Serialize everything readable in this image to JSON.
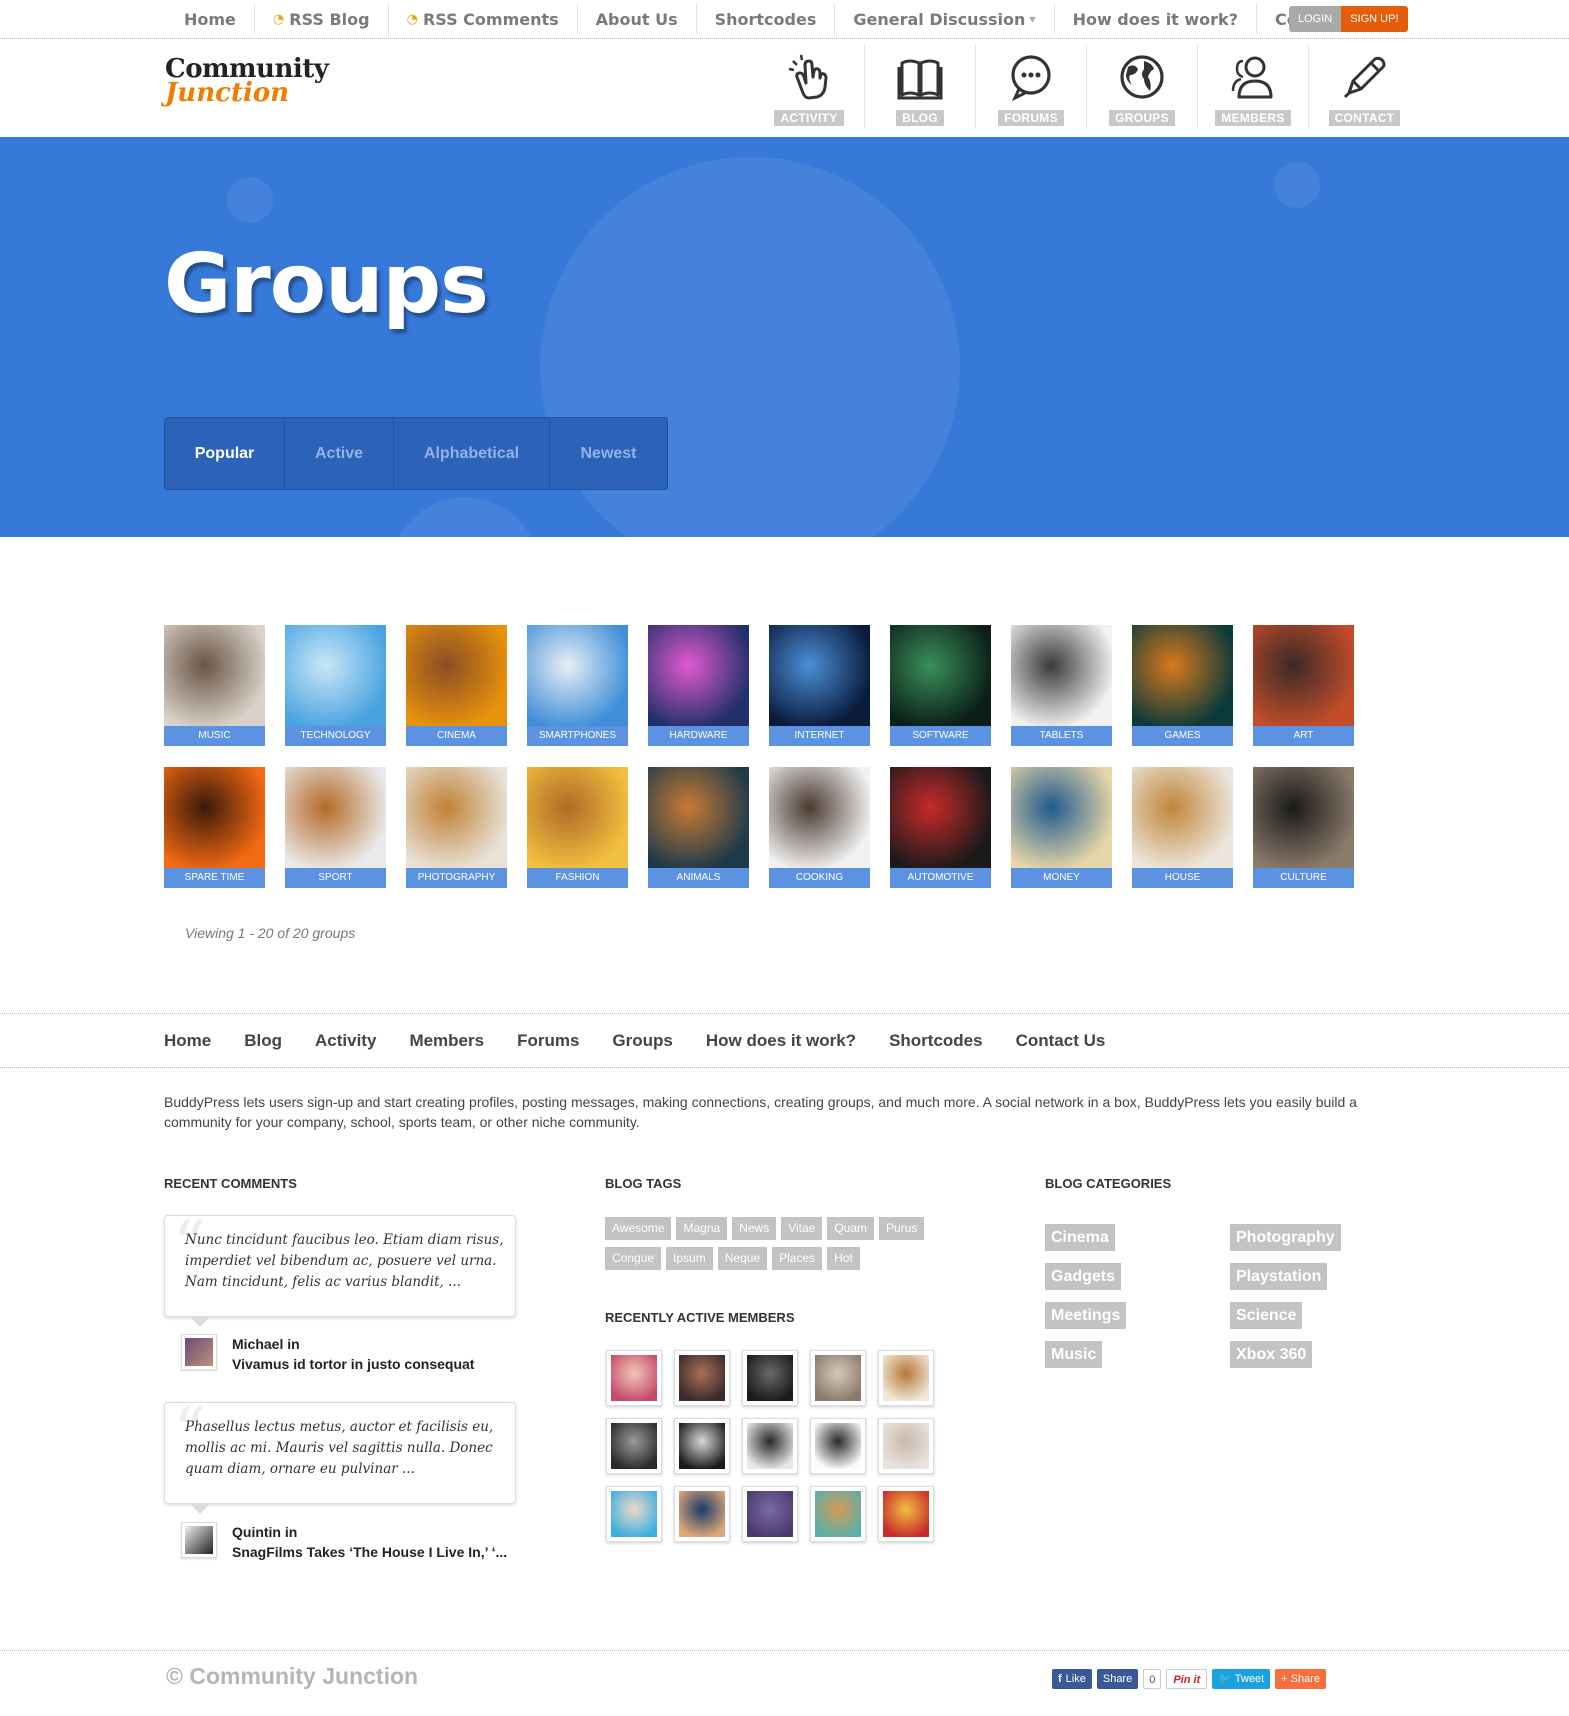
{
  "topnav": {
    "items": [
      {
        "label": "Home",
        "rss": false
      },
      {
        "label": "RSS Blog",
        "rss": true
      },
      {
        "label": "RSS Comments",
        "rss": true
      },
      {
        "label": "About Us",
        "rss": false
      },
      {
        "label": "Shortcodes",
        "rss": false
      },
      {
        "label": "General Discussion",
        "rss": false,
        "caret": true
      },
      {
        "label": "How does it work?",
        "rss": false
      },
      {
        "label": "Contact Us",
        "rss": false
      }
    ],
    "login": "LOGIN",
    "signup": "SIGN UP!"
  },
  "logo": {
    "line1": "Community",
    "line2": "Junction"
  },
  "iconnav": [
    {
      "label": "ACTIVITY",
      "icon": "pointer-hand-icon"
    },
    {
      "label": "BLOG",
      "icon": "book-icon"
    },
    {
      "label": "FORUMS",
      "icon": "chat-bubbles-icon"
    },
    {
      "label": "GROUPS",
      "icon": "globe-icon"
    },
    {
      "label": "MEMBERS",
      "icon": "people-icon"
    },
    {
      "label": "CONTACT",
      "icon": "pencil-icon"
    }
  ],
  "hero": {
    "title": "Groups",
    "tabs": [
      {
        "label": "Popular",
        "active": true
      },
      {
        "label": "Active",
        "active": false
      },
      {
        "label": "Alphabetical",
        "active": false
      },
      {
        "label": "Newest",
        "active": false
      }
    ]
  },
  "groups": [
    {
      "label": "MUSIC",
      "colors": [
        "#d8d2c8",
        "#6b5446"
      ]
    },
    {
      "label": "TECHNOLOGY",
      "colors": [
        "#4aa3e0",
        "#c8e7f7"
      ]
    },
    {
      "label": "CINEMA",
      "colors": [
        "#e8920c",
        "#8a4d24"
      ]
    },
    {
      "label": "SMARTPHONES",
      "colors": [
        "#3f8fd8",
        "#e8eef5"
      ]
    },
    {
      "label": "HARDWARE",
      "colors": [
        "#21306a",
        "#e05ad0"
      ]
    },
    {
      "label": "INTERNET",
      "colors": [
        "#0a1a3a",
        "#4b8fd6"
      ]
    },
    {
      "label": "SOFTWARE",
      "colors": [
        "#0b1e18",
        "#3a8f59"
      ]
    },
    {
      "label": "TABLETS",
      "colors": [
        "#f2f2f2",
        "#3a3a3a"
      ]
    },
    {
      "label": "GAMES",
      "colors": [
        "#0c3a3a",
        "#d87a1c"
      ]
    },
    {
      "label": "ART",
      "colors": [
        "#c24c2a",
        "#3a2a28"
      ]
    },
    {
      "label": "SPARE TIME",
      "colors": [
        "#f36a12",
        "#3a1a0a"
      ]
    },
    {
      "label": "SPORT",
      "colors": [
        "#eaeaea",
        "#b46a28"
      ]
    },
    {
      "label": "PHOTOGRAPHY",
      "colors": [
        "#e8e2d8",
        "#c08236"
      ]
    },
    {
      "label": "FASHION",
      "colors": [
        "#f2c040",
        "#b06a24"
      ]
    },
    {
      "label": "ANIMALS",
      "colors": [
        "#1e3a4a",
        "#c87a34"
      ]
    },
    {
      "label": "COOKING",
      "colors": [
        "#f2f2f2",
        "#4a3a30"
      ]
    },
    {
      "label": "AUTOMOTIVE",
      "colors": [
        "#1a1a1a",
        "#c82a2a"
      ]
    },
    {
      "label": "MONEY",
      "colors": [
        "#e6d6a8",
        "#1f5a8e"
      ]
    },
    {
      "label": "HOUSE",
      "colors": [
        "#ece6dc",
        "#c0863a"
      ]
    },
    {
      "label": "CULTURE",
      "colors": [
        "#8a7a6a",
        "#1a1a1a"
      ]
    }
  ],
  "viewing": "Viewing 1 - 20 of 20 groups",
  "footer_nav": [
    "Home",
    "Blog",
    "Activity",
    "Members",
    "Forums",
    "Groups",
    "How does it work?",
    "Shortcodes",
    "Contact Us"
  ],
  "about": "BuddyPress lets users sign-up and start creating profiles, posting messages, making connections, creating groups, and much more. A social network in a box, BuddyPress lets you easily build a community for your company, school, sports team, or other niche community.",
  "recent_comments": {
    "title": "RECENT COMMENTS",
    "items": [
      {
        "text": "Nunc tincidunt faucibus leo. Etiam diam risus, imperdiet vel bibendum ac, posuere vel urna. Nam tincidunt, felis ac varius blandit, ...",
        "author": "Michael in",
        "post": "Vivamus id tortor in justo consequat",
        "avatar": [
          "#6b4c7a",
          "#c0907a"
        ]
      },
      {
        "text": "Phasellus lectus metus, auctor et facilisis eu, mollis ac mi. Mauris vel sagittis nulla. Donec quam diam, ornare eu pulvinar ...",
        "author": "Quintin in",
        "post": "SnagFilms Takes ‘The House I Live In,’ ‘...",
        "avatar": [
          "#eeeeee",
          "#222222"
        ]
      }
    ]
  },
  "blog_tags": {
    "title": "BLOG TAGS",
    "items": [
      "Awesome",
      "Magna",
      "News",
      "Vitae",
      "Quam",
      "Purus",
      "Congue",
      "Ipsum",
      "Neque",
      "Places",
      "Hot"
    ]
  },
  "recently_active": {
    "title": "RECENTLY ACTIVE MEMBERS",
    "avatars": [
      [
        "#c44a6a",
        "#f0c8b8"
      ],
      [
        "#3a2a2a",
        "#a87058"
      ],
      [
        "#1a1a1a",
        "#6a6a6a"
      ],
      [
        "#8a7a6a",
        "#d8c8b8"
      ],
      [
        "#f0e8d8",
        "#b87838"
      ],
      [
        "#2a2a2a",
        "#9a9a9a"
      ],
      [
        "#1a1a1a",
        "#d8d8d8"
      ],
      [
        "#e8e8e8",
        "#2a2a2a"
      ],
      [
        "#fafafa",
        "#2a2a2a"
      ],
      [
        "#e8e4e0",
        "#c8b8a8"
      ],
      [
        "#3ab0e0",
        "#f0d8c8"
      ],
      [
        "#e0a878",
        "#1a3a6a"
      ],
      [
        "#4a3a6a",
        "#7a6aa8"
      ],
      [
        "#5ab0a8",
        "#d89858"
      ],
      [
        "#c82a2a",
        "#f0c040"
      ]
    ]
  },
  "blog_categories": {
    "title": "BLOG CATEGORIES",
    "items": [
      "Cinema",
      "Photography",
      "Gadgets",
      "Playstation",
      "Meetings",
      "Science",
      "Music",
      "Xbox 360"
    ]
  },
  "copyright": "© Community Junction",
  "social": {
    "like": "Like",
    "share": "Share",
    "count": "0",
    "pin": "Pin it",
    "tweet": "Tweet",
    "share2": "Share"
  }
}
